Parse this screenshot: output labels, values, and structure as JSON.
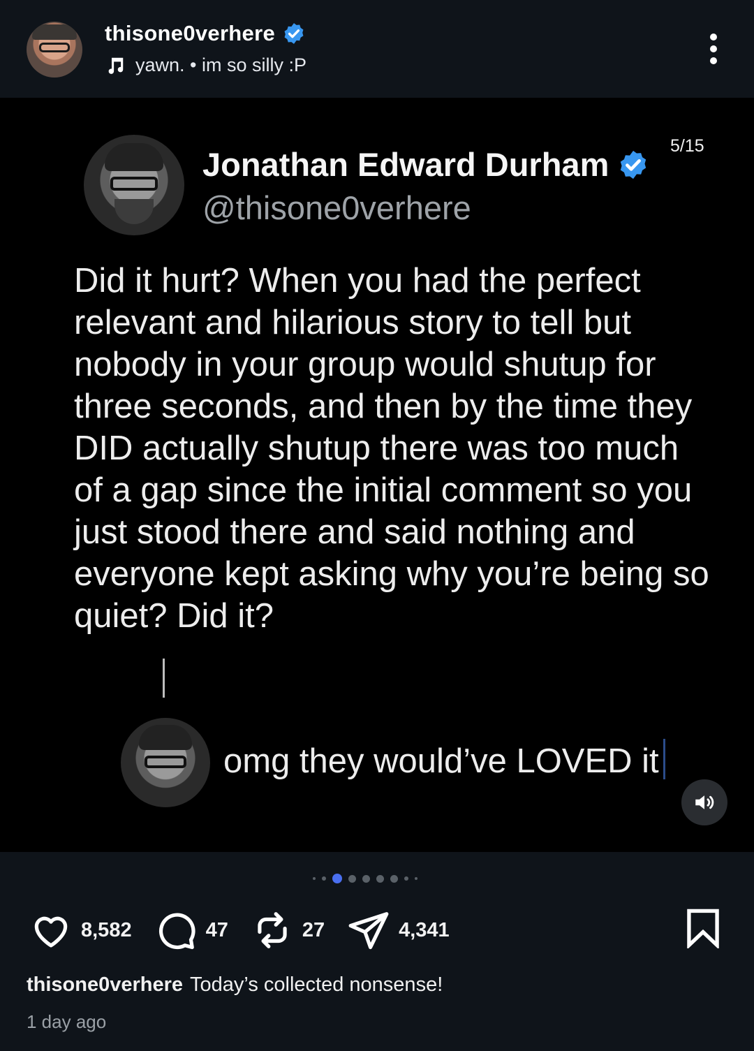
{
  "header": {
    "username": "thisone0verhere",
    "music_text": "yawn. • im so silly :P",
    "verified_icon": "verified-badge-icon",
    "music_icon": "music-note-icon",
    "more_icon": "more-vertical-icon"
  },
  "post_image": {
    "page_counter": "5/15",
    "tweet": {
      "display_name": "Jonathan Edward Durham",
      "handle": "@thisone0verhere",
      "text": "Did it hurt? When you had the perfect relevant and hilarious story to tell but nobody in your group would shutup for three seconds, and then by the time they DID actually shutup there was too much of a gap since the initial comment so you just stood there and said nothing and everyone kept asking why you’re being so quiet? Did it?"
    },
    "reply": {
      "text": "omg they would’ve LOVED it"
    },
    "sound_icon": "speaker-volume-icon"
  },
  "carousel": {
    "total_dots_visible": 9,
    "active_index": 2
  },
  "actions": {
    "likes": "8,582",
    "comments": "47",
    "reposts": "27",
    "shares": "4,341"
  },
  "caption": {
    "username": "thisone0verhere",
    "text": "Today’s collected nonsense!"
  },
  "timestamp": "1 day ago",
  "colors": {
    "background": "#0f141a",
    "verified_blue": "#3897f0",
    "active_dot": "#4a6ff0"
  }
}
